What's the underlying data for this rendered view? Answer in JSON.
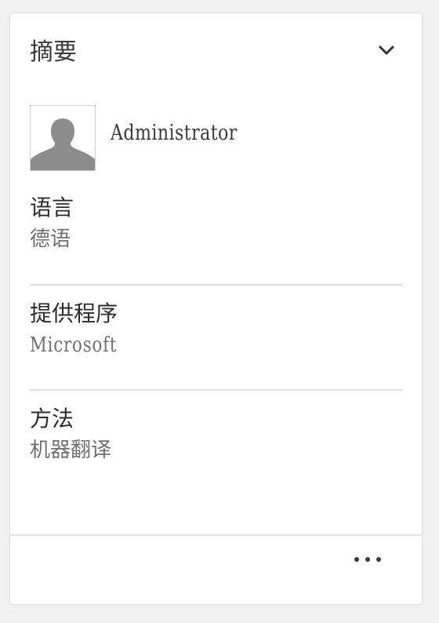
{
  "summary": {
    "title": "摘要",
    "collapse_icon": "chevron-down-icon"
  },
  "user": {
    "name": "Administrator",
    "avatar_icon": "user-silhouette-icon"
  },
  "fields": [
    {
      "label": "语言",
      "value": "德语"
    },
    {
      "label": "提供程序",
      "value": "Microsoft"
    },
    {
      "label": "方法",
      "value": "机器翻译"
    }
  ],
  "footer": {
    "more_icon": "more-horizontal-icon"
  },
  "colors": {
    "background": "#f0f0f0",
    "card": "#ffffff",
    "text_primary": "#2c2c2c",
    "text_secondary": "#707070",
    "divider": "#dedede",
    "avatar_silhouette": "#8c8c8c"
  }
}
